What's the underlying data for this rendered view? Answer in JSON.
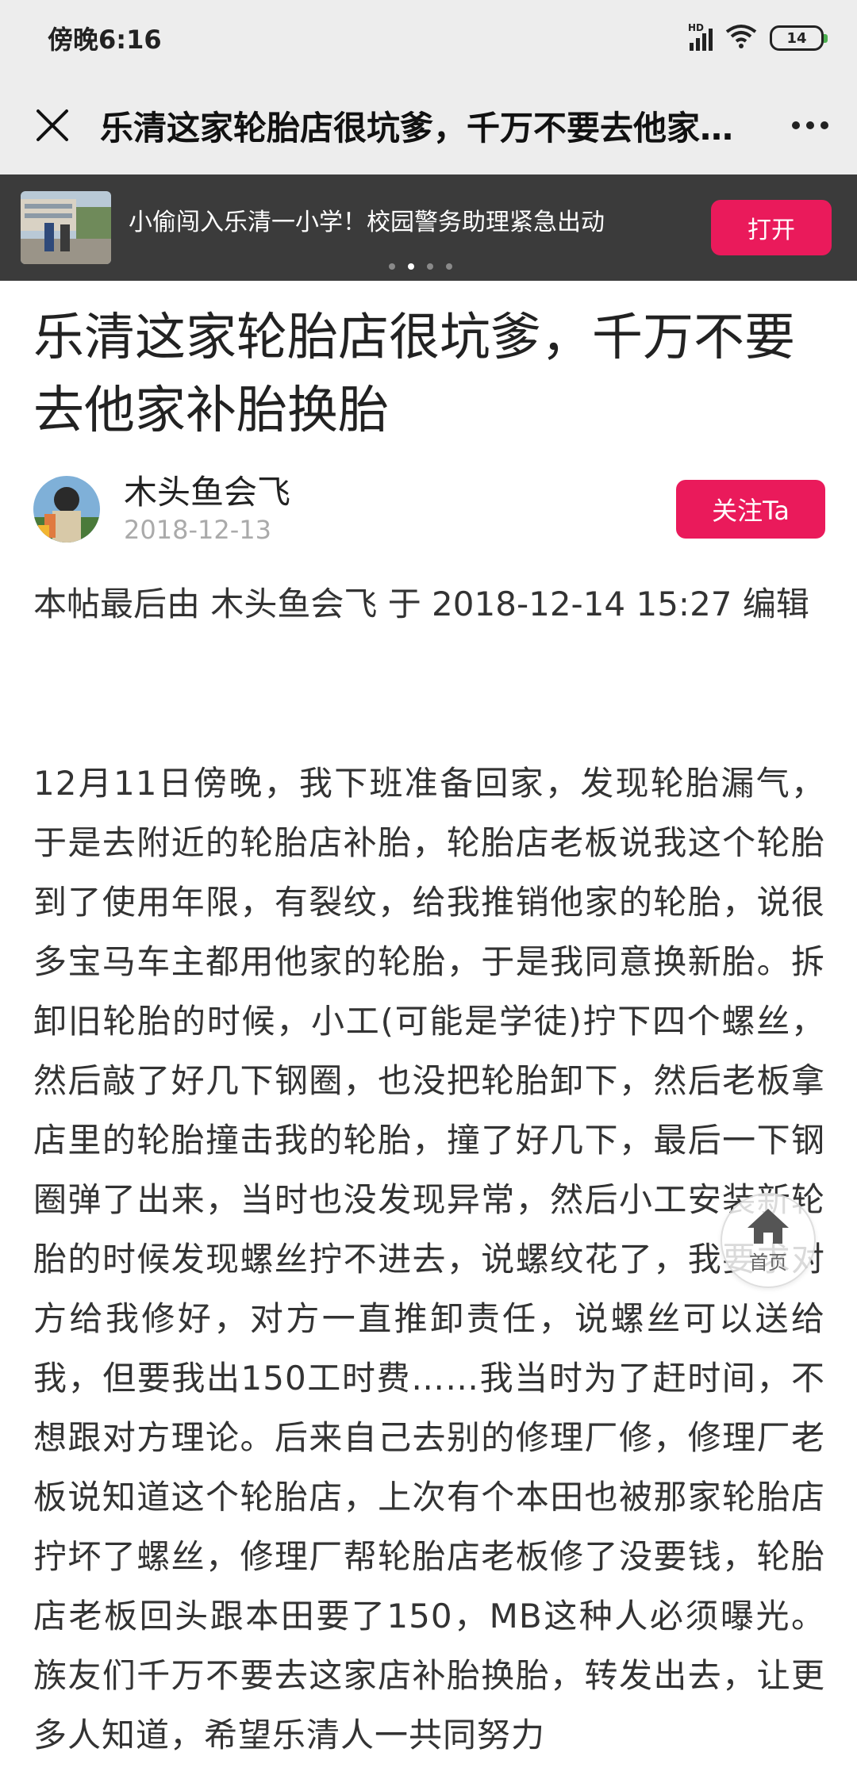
{
  "status_bar": {
    "time": "傍晚6:16",
    "network": "HD",
    "battery": "14"
  },
  "nav": {
    "title": "乐清这家轮胎店很坑爹，千万不要去他家补胎换胎"
  },
  "ad": {
    "text": "小偷闯入乐清一小学！校园警务助理紧急出动",
    "open_label": "打开",
    "carousel_count": 4,
    "carousel_active": 2
  },
  "article": {
    "title": "乐清这家轮胎店很坑爹，千万不要去他家补胎换胎",
    "author": {
      "name": "木头鱼会飞",
      "date": "2018-12-13",
      "follow_label": "关注Ta"
    },
    "edit_note": "本帖最后由 木头鱼会飞 于 2018-12-14 15:27 编辑",
    "body": "12月11日傍晚，我下班准备回家，发现轮胎漏气，于是去附近的轮胎店补胎，轮胎店老板说我这个轮胎到了使用年限，有裂纹，给我推销他家的轮胎，说很多宝马车主都用他家的轮胎，于是我同意换新胎。拆卸旧轮胎的时候，小工(可能是学徒)拧下四个螺丝，然后敲了好几下钢圈，也没把轮胎卸下，然后老板拿店里的轮胎撞击我的轮胎，撞了好几下，最后一下钢圈弹了出来，当时也没发现异常，然后小工安装新轮胎的时候发现螺丝拧不进去，说螺纹花了，我要求对方给我修好，对方一直推卸责任，说螺丝可以送给我，但要我出150工时费……我当时为了赶时间，不想跟对方理论。后来自己去别的修理厂修，修理厂老板说知道这个轮胎店，上次有个本田也被那家轮胎店拧坏了螺丝，修理厂帮轮胎店老板修了没要钱，轮胎店老板回头跟本田要了150，MB这种人必须曝光。族友们千万不要去这家店补胎换胎，转发出去，让更多人知道，希望乐清人一共同努力"
  },
  "fab": {
    "home_label": "首页"
  },
  "colors": {
    "accent": "#ea1a5b",
    "banner_bg": "#3b3b3b",
    "header_bg": "#ededed"
  }
}
